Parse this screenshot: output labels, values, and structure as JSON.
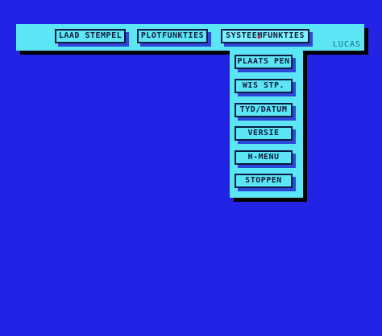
{
  "menubar": {
    "items": [
      {
        "label": "LAAD STEMPEL"
      },
      {
        "label": "PLOTFUNKTIES"
      },
      {
        "label": "SYSTEEMFUNKTIES"
      }
    ],
    "logo": "LUCAS"
  },
  "dropdown": {
    "items": [
      {
        "label": "PLAATS PEN"
      },
      {
        "label": "WIS STP."
      },
      {
        "label": "TYD/DATUM"
      },
      {
        "label": "VERSIE"
      },
      {
        "label": "H-MENU"
      },
      {
        "label": "STOPPEN"
      }
    ]
  },
  "colors": {
    "background": "#2323e6",
    "panel": "#5ce6f5",
    "shadow": "#000000",
    "button_shadow": "#2b48d8"
  }
}
